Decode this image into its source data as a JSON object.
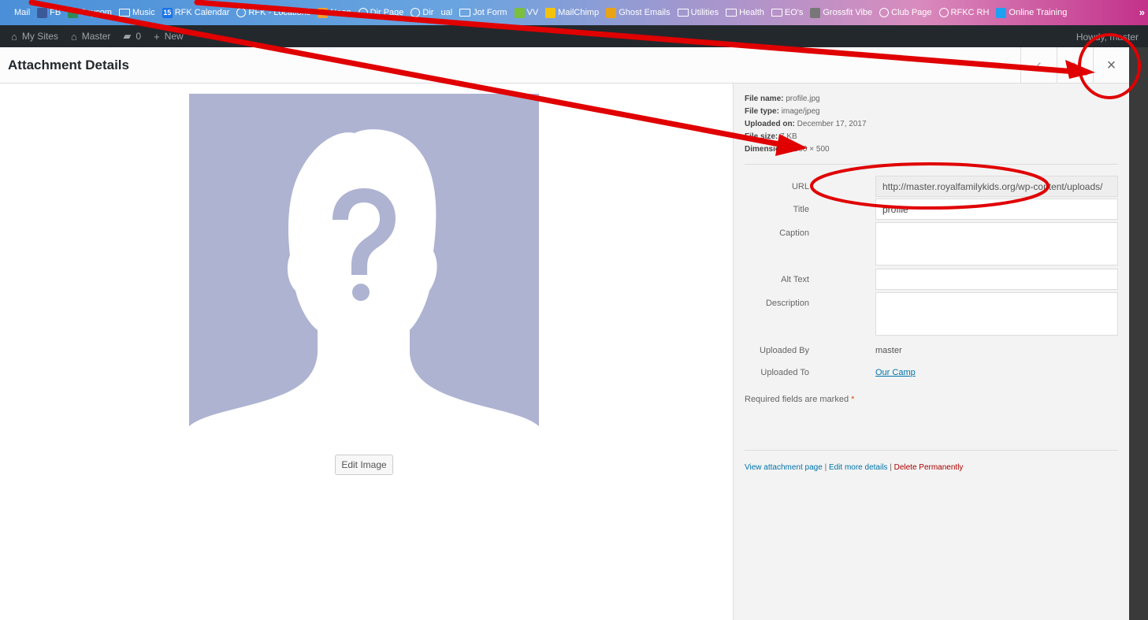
{
  "bookmarks": [
    {
      "label": "Mail",
      "icon": "mail-icon",
      "color": "#4a8fd8"
    },
    {
      "label": "FB",
      "icon": "facebook-icon",
      "color": "#3b5998"
    },
    {
      "label": "Paycom",
      "icon": "paycom-icon",
      "color": "#2e8b57"
    },
    {
      "label": "Music",
      "icon": "folder-icon"
    },
    {
      "label": "RFK Calendar",
      "icon": "calendar-icon",
      "color": "#1a73e8",
      "badge": "15"
    },
    {
      "label": "RFK - Locations",
      "icon": "globe-icon"
    },
    {
      "label": "Neon",
      "icon": "neon-icon",
      "color": "#f0a030"
    },
    {
      "label": "Dir Page",
      "icon": "globe-icon"
    },
    {
      "label": "Dir",
      "icon": "globe-icon"
    },
    {
      "label": "ual",
      "icon": "none"
    },
    {
      "label": "Jot Form",
      "icon": "folder-icon"
    },
    {
      "label": "VV",
      "icon": "vv-icon",
      "color": "#7cbf3c"
    },
    {
      "label": "MailChimp",
      "icon": "mailchimp-icon",
      "color": "#f4c20d"
    },
    {
      "label": "Ghost Emails",
      "icon": "ghost-icon",
      "color": "#e8a317"
    },
    {
      "label": "Utilities",
      "icon": "folder-icon"
    },
    {
      "label": "Health",
      "icon": "folder-icon"
    },
    {
      "label": "EO's",
      "icon": "folder-icon"
    },
    {
      "label": "Grossfit Vibe",
      "icon": "crossfit-icon"
    },
    {
      "label": "Club Page",
      "icon": "globe-icon"
    },
    {
      "label": "RFKC RH",
      "icon": "globe-icon"
    },
    {
      "label": "Online Training",
      "icon": "s-icon",
      "color": "#1da1f2"
    }
  ],
  "adminbar": {
    "my_sites": "My Sites",
    "master": "Master",
    "comments_count": "0",
    "new": "New",
    "howdy": "Howdy, master"
  },
  "header": {
    "title": "Attachment Details",
    "prev": "‹",
    "next": "›",
    "close": "×"
  },
  "preview": {
    "bg_color": "#aeb3d2",
    "fg_color": "#ffffff",
    "edit_label": "Edit Image"
  },
  "meta": {
    "file_name_label": "File name:",
    "file_name": "profile.jpg",
    "file_type_label": "File type:",
    "file_type": "image/jpeg",
    "uploaded_on_label": "Uploaded on:",
    "uploaded_on": "December 17, 2017",
    "file_size_label": "File size:",
    "file_size": "7 KB",
    "dimensions_label": "Dimensions:",
    "dimensions": "500 × 500"
  },
  "fields": {
    "url_label": "URL",
    "url_value": "http://master.royalfamilykids.org/wp-content/uploads/",
    "title_label": "Title",
    "title_value": "profile",
    "caption_label": "Caption",
    "caption_value": "",
    "alt_label": "Alt Text",
    "alt_value": "",
    "description_label": "Description",
    "description_value": "",
    "uploaded_by_label": "Uploaded By",
    "uploaded_by_value": "master",
    "uploaded_to_label": "Uploaded To",
    "uploaded_to_value": "Our Camp"
  },
  "required": {
    "text": "Required fields are marked",
    "star": "*"
  },
  "actions": {
    "view": "View attachment page",
    "sep": "|",
    "edit": "Edit more details",
    "delete": "Delete Permanently"
  },
  "annotation_color": "#e00000"
}
